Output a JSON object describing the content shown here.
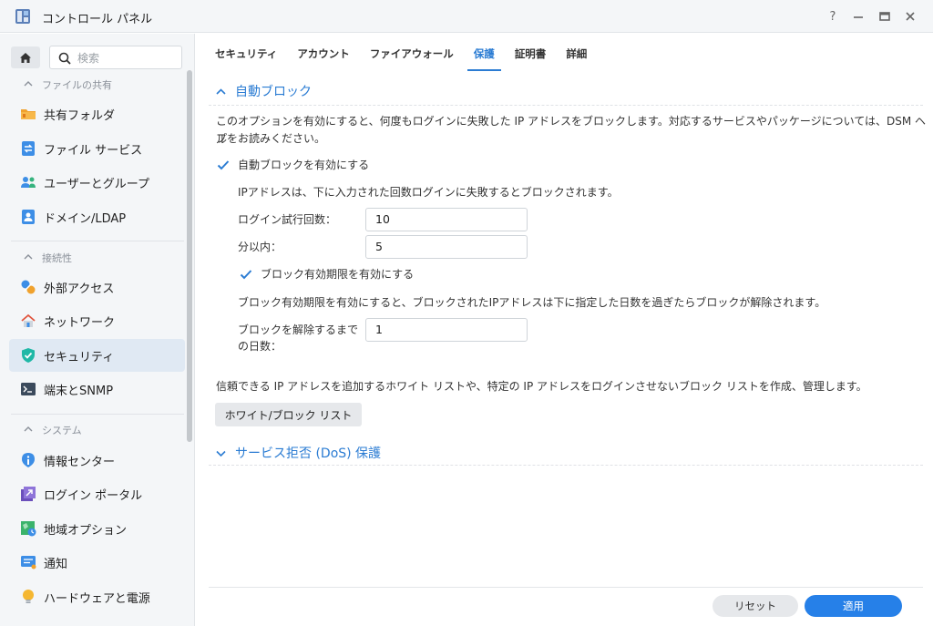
{
  "window": {
    "title": "コントロール パネル",
    "help_label": "?"
  },
  "sidebar": {
    "search_placeholder": "検索",
    "sections": [
      {
        "label": "ファイルの共有"
      },
      {
        "label": "接続性"
      },
      {
        "label": "システム"
      }
    ],
    "items": [
      {
        "label": "共有フォルダ",
        "icon": "folder-icon"
      },
      {
        "label": "ファイル サービス",
        "icon": "file-services-icon"
      },
      {
        "label": "ユーザーとグループ",
        "icon": "users-icon"
      },
      {
        "label": "ドメイン/LDAP",
        "icon": "domain-icon"
      },
      {
        "label": "外部アクセス",
        "icon": "external-access-icon"
      },
      {
        "label": "ネットワーク",
        "icon": "network-icon"
      },
      {
        "label": "セキュリティ",
        "icon": "shield-icon",
        "active": true
      },
      {
        "label": "端末とSNMP",
        "icon": "terminal-icon"
      },
      {
        "label": "情報センター",
        "icon": "info-icon"
      },
      {
        "label": "ログイン ポータル",
        "icon": "login-portal-icon"
      },
      {
        "label": "地域オプション",
        "icon": "regional-icon"
      },
      {
        "label": "通知",
        "icon": "notification-icon"
      },
      {
        "label": "ハードウェアと電源",
        "icon": "hardware-icon"
      }
    ]
  },
  "tabs": [
    {
      "label": "セキュリティ"
    },
    {
      "label": "アカウント"
    },
    {
      "label": "ファイアウォール"
    },
    {
      "label": "保護",
      "active": true
    },
    {
      "label": "証明書"
    },
    {
      "label": "詳細"
    }
  ],
  "auto_block": {
    "title": "自動ブロック",
    "description_line1": "このオプションを有効にすると、何度もログインに失敗した IP アドレスをブロックします。対応するサービスやパッケージについては、DSM ヘル",
    "description_line2": "プをお読みください。",
    "enable_label": "自動ブロックを有効にする",
    "enable_checked": true,
    "rule_text": "IPアドレスは、下に入力された回数ログインに失敗するとブロックされます。",
    "attempts_label": "ログイン試行回数：",
    "attempts_value": "10",
    "minutes_label": "分以内：",
    "minutes_value": "5",
    "expiration_label": "ブロック有効期限を有効にする",
    "expiration_checked": true,
    "expiration_text": "ブロック有効期限を有効にすると、ブロックされたIPアドレスは下に指定した日数を過ぎたらブロックが解除されます。",
    "unblock_label_line1": "ブロックを解除するまで",
    "unblock_label_line2": "の日数：",
    "unblock_value": "1",
    "allowlist_text": "信頼できる IP アドレスを追加するホワイト リストや、特定の IP アドレスをログインさせないブロック リストを作成、管理します。",
    "allowlist_button": "ホワイト/ブロック リスト"
  },
  "dos": {
    "title": "サービス拒否 (DoS) 保護"
  },
  "footer": {
    "reset_label": "リセット",
    "apply_label": "適用"
  },
  "colors": {
    "accent": "#2b7cd3",
    "apply_button": "#2680e8",
    "active_nav": "#e0e9f3"
  }
}
